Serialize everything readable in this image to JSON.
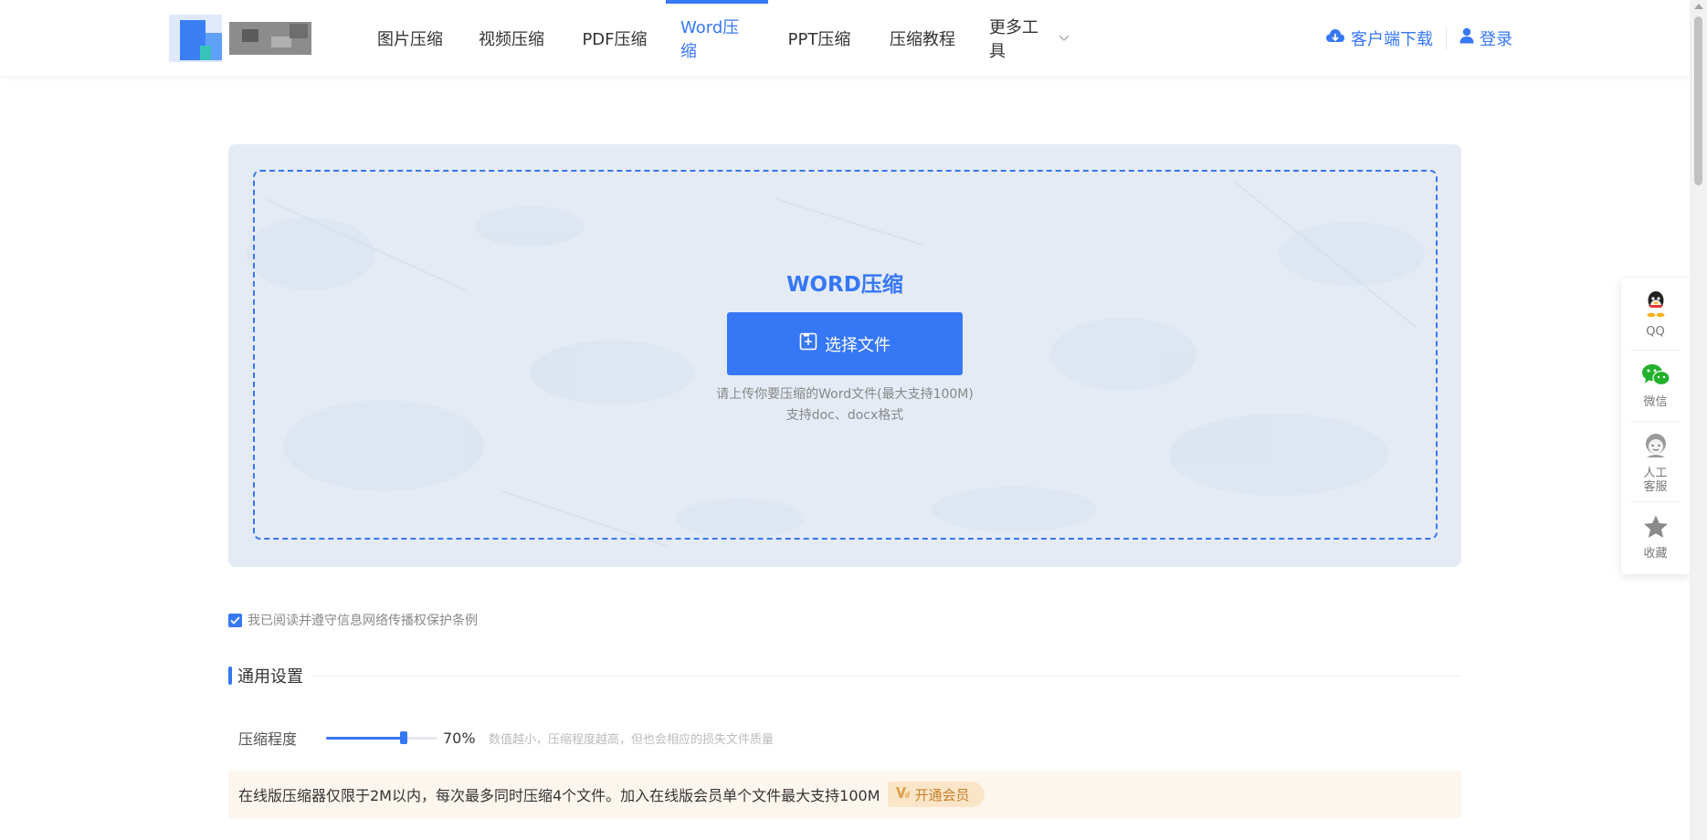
{
  "nav": {
    "items": [
      {
        "label": "图片压缩",
        "active": false
      },
      {
        "label": "视频压缩",
        "active": false
      },
      {
        "label": "PDF压缩",
        "active": false
      },
      {
        "label": "Word压缩",
        "active": true
      },
      {
        "label": "PPT压缩",
        "active": false
      },
      {
        "label": "压缩教程",
        "active": false
      },
      {
        "label": "更多工具",
        "active": false
      }
    ],
    "download_label": "客户端下载",
    "login_label": "登录"
  },
  "upload": {
    "title": "WORD压缩",
    "select_button": "选择文件",
    "hint_line1": "请上传你要压缩的Word文件(最大支持100M)",
    "hint_line2": "支持doc、docx格式"
  },
  "agreement": {
    "checked": true,
    "text": "我已阅读并遵守信息网络传播权保护条例"
  },
  "settings": {
    "section_title": "通用设置",
    "compression_label": "压缩程度",
    "compression_value": 0.7,
    "compression_value_text": "70%",
    "compression_hint": "数值越小，压缩程度越高，但也会相应的损失文件质量"
  },
  "notice": {
    "text": "在线版压缩器仅限于2M以内，每次最多同时压缩4个文件。加入在线版会员单个文件最大支持100M",
    "vip_button": "开通会员"
  },
  "float_bar": {
    "qq": "QQ",
    "wechat": "微信",
    "service": "人工\n客服",
    "favorite": "收藏"
  },
  "colors": {
    "accent": "#3677f6",
    "panel_bg": "#e4ebf4",
    "notice_bg": "#fdf6ee",
    "vip_text": "#c7812d"
  }
}
